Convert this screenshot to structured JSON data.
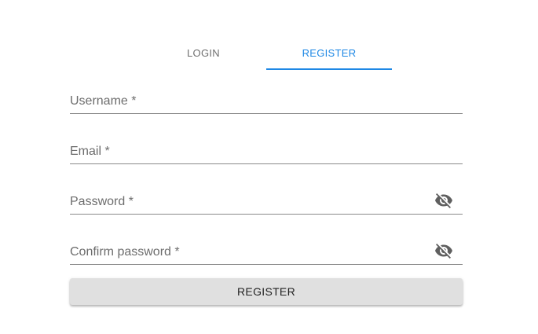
{
  "tabs": [
    {
      "label": "LOGIN",
      "active": false
    },
    {
      "label": "REGISTER",
      "active": true
    }
  ],
  "form": {
    "username": {
      "label": "Username *",
      "value": ""
    },
    "email": {
      "label": "Email *",
      "value": ""
    },
    "password": {
      "label": "Password *",
      "value": "",
      "icon": "visibility-off-icon"
    },
    "confirm_password": {
      "label": "Confirm password *",
      "value": "",
      "icon": "visibility-off-icon"
    },
    "submit_label": "REGISTER"
  },
  "colors": {
    "accent": "#1e88e5",
    "inactive_tab": "#6f6f6f",
    "button_bg": "#e0e0e0",
    "field_label": "#6d6d6d",
    "underline": "#8a8a8a"
  }
}
